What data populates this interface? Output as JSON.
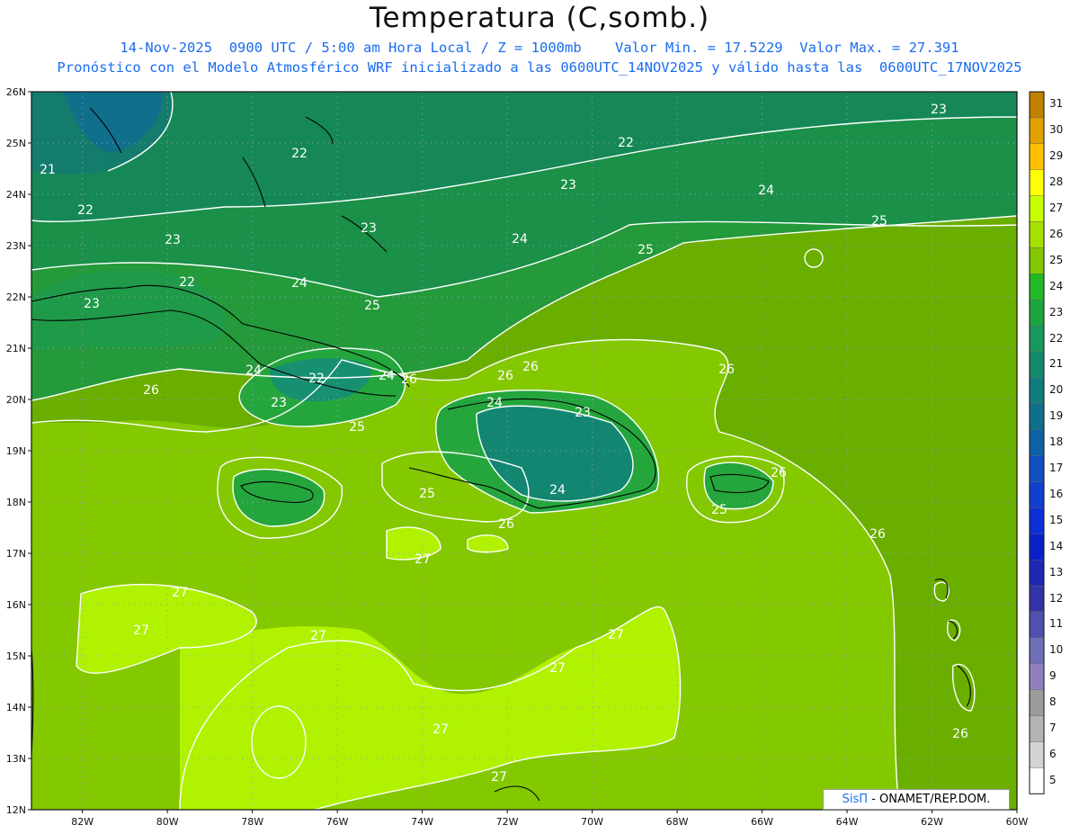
{
  "title": "Temperatura (C,somb.)",
  "subtitle_1": "14-Nov-2025  0900 UTC / 5:00 am Hora Local / Z = 1000mb    Valor Min. = 17.5229  Valor Max. = 27.391",
  "subtitle_2": "Pronóstico con el Modelo Atmosférico WRF inicializado a las 0600UTC_14NOV2025 y válido hasta las  0600UTC_17NOV2025",
  "credit": {
    "brand": "SisΠ",
    "text": " - ONAMET/REP.DOM."
  },
  "lat_labels": [
    "26N",
    "25N",
    "24N",
    "23N",
    "22N",
    "21N",
    "20N",
    "19N",
    "18N",
    "17N",
    "16N",
    "15N",
    "14N",
    "13N",
    "12N"
  ],
  "lon_labels": [
    "82W",
    "80W",
    "78W",
    "76W",
    "74W",
    "72W",
    "70W",
    "68W",
    "66W",
    "64W",
    "62W",
    "60W"
  ],
  "legend": {
    "values": [
      "31",
      "30",
      "29",
      "28",
      "27",
      "26",
      "25",
      "24",
      "23",
      "22",
      "21",
      "20",
      "19",
      "18",
      "17",
      "16",
      "15",
      "14",
      "13",
      "12",
      "11",
      "10",
      "9",
      "8",
      "7",
      "6",
      "5"
    ],
    "colors": [
      "#c08000",
      "#e0a000",
      "#ffc000",
      "#ffff00",
      "#c8ff00",
      "#a8e000",
      "#84c800",
      "#24b824",
      "#1ca640",
      "#18985c",
      "#148a6c",
      "#107c7c",
      "#10708c",
      "#1060a8",
      "#1050c0",
      "#1040d0",
      "#0c30d8",
      "#0820c8",
      "#1c28b4",
      "#3434a8",
      "#5050b0",
      "#7070b8",
      "#9080c0",
      "#9c9c9c",
      "#b4b4b4",
      "#d4d4d4",
      "#ffffff"
    ]
  },
  "contour_labels": [
    "21",
    "22",
    "22",
    "22",
    "23",
    "23",
    "23",
    "23",
    "22",
    "23",
    "24",
    "24",
    "24",
    "25",
    "25",
    "25",
    "24",
    "26",
    "24",
    "22",
    "24",
    "23",
    "23",
    "24",
    "26",
    "26",
    "26",
    "25",
    "26",
    "26",
    "25",
    "25",
    "26",
    "26",
    "27",
    "27",
    "27",
    "27",
    "27",
    "27",
    "27",
    "27",
    "26"
  ],
  "colors": {
    "frame": "#111111",
    "contour": "#ffffff",
    "coast": "#000000",
    "grid": "#9999cc"
  }
}
